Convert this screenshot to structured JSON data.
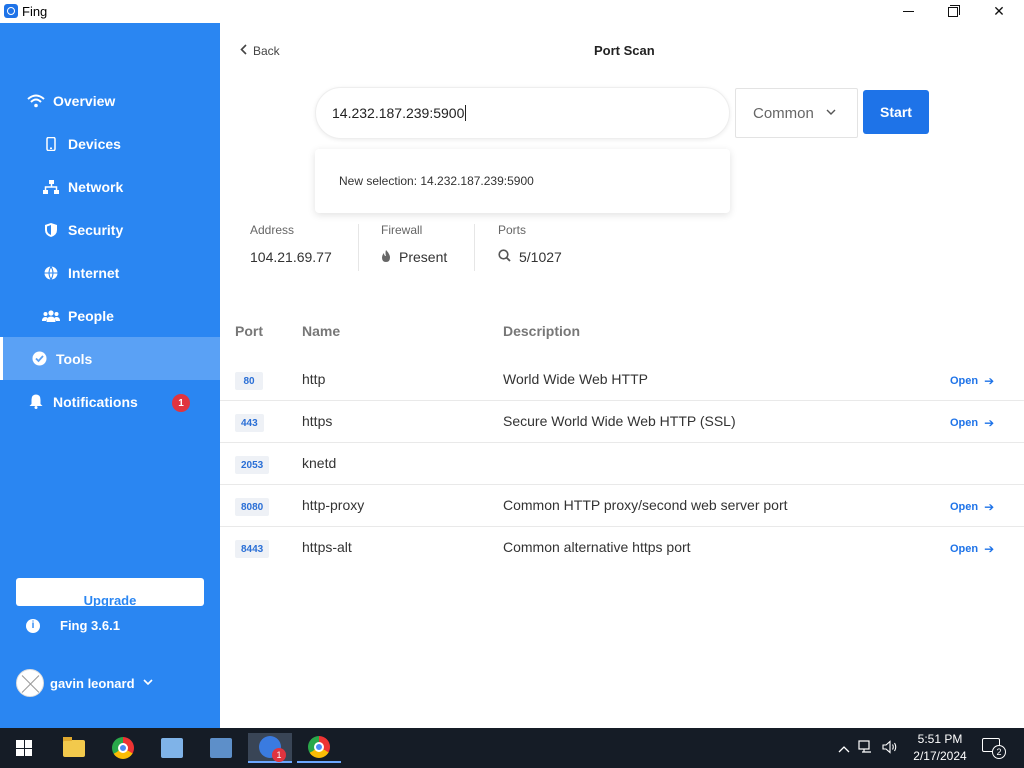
{
  "window": {
    "title": "Fing"
  },
  "sidebar": {
    "items": [
      {
        "label": "Overview",
        "icon": "wifi-icon"
      },
      {
        "label": "Devices",
        "icon": "phone-icon"
      },
      {
        "label": "Network",
        "icon": "network-icon"
      },
      {
        "label": "Security",
        "icon": "shield-icon"
      },
      {
        "label": "Internet",
        "icon": "globe-icon"
      },
      {
        "label": "People",
        "icon": "people-icon"
      },
      {
        "label": "Tools",
        "icon": "check-circle-icon",
        "active": true
      },
      {
        "label": "Notifications",
        "icon": "bell-icon",
        "badge": "1"
      }
    ],
    "upgrade_label": "Upgrade",
    "version": "Fing 3.6.1",
    "user_name": "gavin leonard"
  },
  "header": {
    "back_label": "Back",
    "title": "Port Scan"
  },
  "scan": {
    "target_value": "14.232.187.239:5900",
    "mode_value": "Common",
    "start_label": "Start",
    "suggestion": "New selection: 14.232.187.239:5900"
  },
  "stats": {
    "address_label": "Address",
    "address_value": "104.21.69.77",
    "firewall_label": "Firewall",
    "firewall_value": "Present",
    "ports_label": "Ports",
    "ports_value": "5/1027"
  },
  "table": {
    "headers": [
      "Port",
      "Name",
      "Description"
    ],
    "rows": [
      {
        "port": "80",
        "name": "http",
        "description": "World Wide Web HTTP",
        "action": "Open"
      },
      {
        "port": "443",
        "name": "https",
        "description": "Secure World Wide Web HTTP (SSL)",
        "action": "Open"
      },
      {
        "port": "2053",
        "name": "knetd",
        "description": "",
        "action": ""
      },
      {
        "port": "8080",
        "name": "http-proxy",
        "description": "Common HTTP proxy/second web server port",
        "action": "Open"
      },
      {
        "port": "8443",
        "name": "https-alt",
        "description": "Common alternative https port",
        "action": "Open"
      }
    ]
  },
  "taskbar": {
    "time": "5:51 PM",
    "date": "2/17/2024",
    "notification_count": "2",
    "fing_badge": "1"
  },
  "colors": {
    "sidebar": "#2a86f2",
    "accent": "#1e73e8",
    "badge": "#e0343f"
  }
}
